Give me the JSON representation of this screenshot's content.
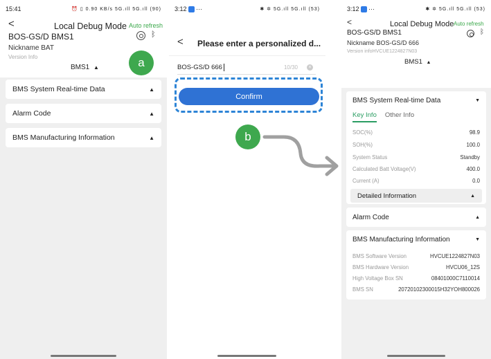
{
  "phone1": {
    "status": {
      "time": "15:41",
      "icons": "⏰ ▯ 0.90 KB/s 5G.ıll 5G.ıll (90)"
    },
    "header": {
      "back": "<",
      "title": "Local Debug Mode",
      "auto_refresh": "Auto refresh",
      "device": "BOS-GS/D  BMS1",
      "nickname": "Nickname  BAT",
      "version_info": "Version Info",
      "bms_selector": "BMS1",
      "bms_selector_caret": "▲"
    },
    "badge": "a",
    "sections": [
      {
        "label": "BMS System Real-time Data",
        "caret": "▲"
      },
      {
        "label": "Alarm Code",
        "caret": "▲"
      },
      {
        "label": "BMS Manufacturing Information",
        "caret": "▲"
      }
    ]
  },
  "phone2": {
    "status": {
      "time": "3:12",
      "icons": "✱ ✲ 5G.ıll 5G.ıll (53)"
    },
    "back": "<",
    "title": "Please enter a personalized d...",
    "input_value": "BOS-GS/D  666",
    "char_count": "10/30",
    "confirm_label": "Confirm",
    "badge": "b"
  },
  "phone3": {
    "status": {
      "time": "3:12",
      "icons": "✱ ✲ 5G.ıll 5G.ıll (53)"
    },
    "header": {
      "back": "<",
      "title": "Local Debug Mode",
      "auto_refresh": "Auto refresh",
      "device": "BOS-GS/D  BMS1",
      "nickname": "Nickname  BOS-GS/D  666",
      "version_info": "Version infoHVCUE1224827N03",
      "bms_selector": "BMS1",
      "bms_selector_caret": "▲"
    },
    "realtime": {
      "title": "BMS System Real-time Data",
      "caret": "▼",
      "tabs": [
        "Key Info",
        "Other Info"
      ],
      "rows": [
        {
          "key": "SOC(%)",
          "value": "98.9"
        },
        {
          "key": "SOH(%)",
          "value": "100.0"
        },
        {
          "key": "System Status",
          "value": "Standby"
        },
        {
          "key": "Calculated Batt Voltage(V)",
          "value": "400.0"
        },
        {
          "key": "Current (A)",
          "value": "0.0"
        }
      ],
      "detailed": "Detailed Information",
      "detailed_caret": "▲"
    },
    "alarm": {
      "title": "Alarm Code",
      "caret": "▲"
    },
    "manufacturing": {
      "title": "BMS Manufacturing Information",
      "caret": "▼",
      "rows": [
        {
          "key": "BMS Software Version",
          "value": "HVCUE1224827N03"
        },
        {
          "key": "BMS Hardware Version",
          "value": "HVCU06_12S"
        },
        {
          "key": "High Voltage Box SN",
          "value": "08401000C7110014"
        },
        {
          "key": "BMS SN",
          "value": "20720102300015H32YOH800026"
        }
      ]
    }
  },
  "colors": {
    "green": "#3ea84e",
    "blue": "#2f72d4",
    "dash_blue": "#2d84d6",
    "arrow_gray": "#a0a0a0"
  }
}
